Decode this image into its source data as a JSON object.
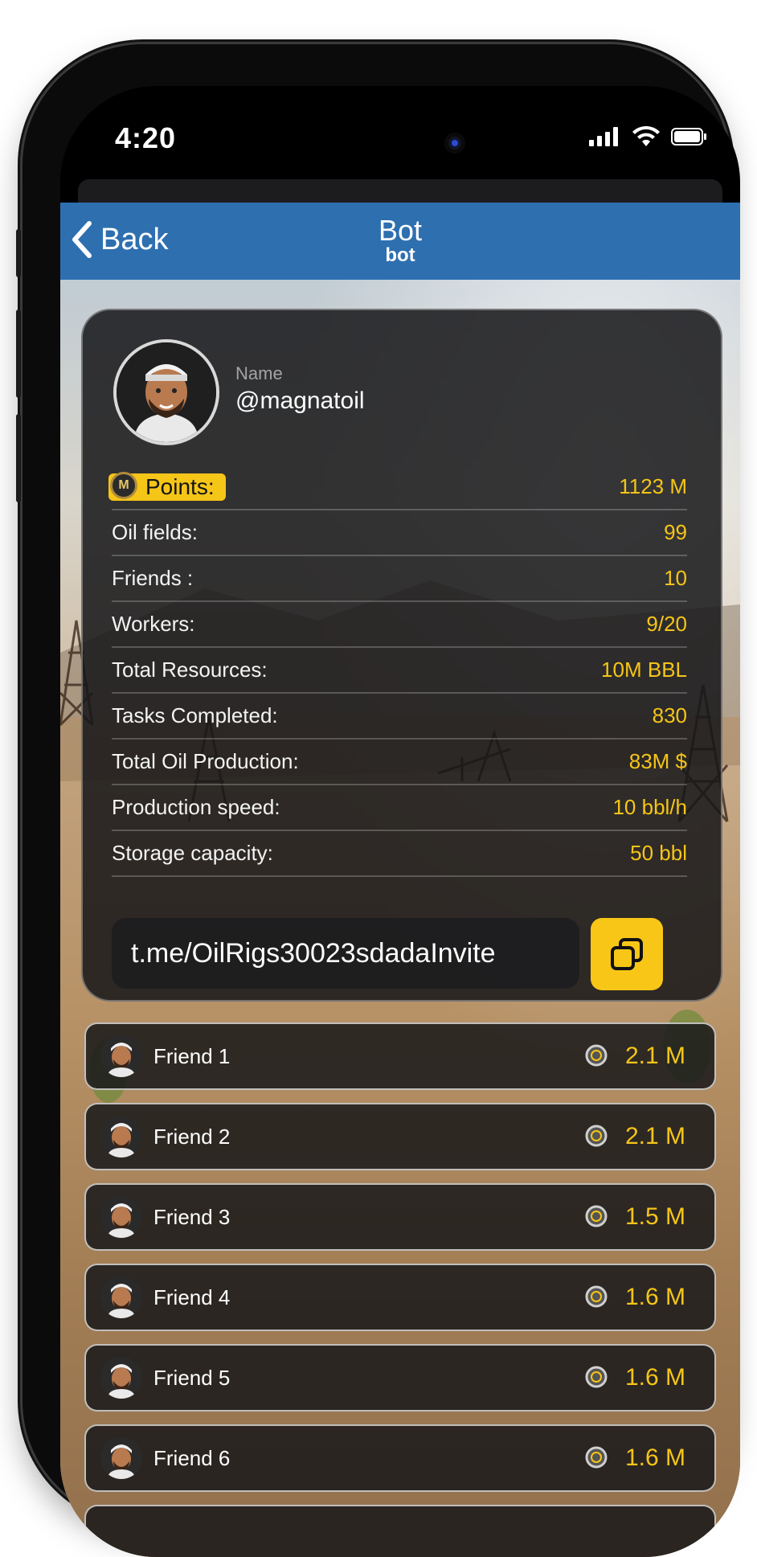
{
  "status_bar": {
    "time": "4:20"
  },
  "nav": {
    "back_label": "Back",
    "title": "Bot",
    "subtitle": "bot"
  },
  "profile": {
    "name_label": "Name",
    "username": "@magnatoil"
  },
  "points": {
    "label": "Points:",
    "coin_letter": "M",
    "value": "1123 M"
  },
  "stats": [
    {
      "label": "Oil fields:",
      "value": "99"
    },
    {
      "label": "Friends :",
      "value": "10"
    },
    {
      "label": "Workers:",
      "value": "9/20"
    },
    {
      "label": "Total Resources:",
      "value": "10M BBL"
    },
    {
      "label": "Tasks Completed:",
      "value": "830"
    },
    {
      "label": "Total Oil Production:",
      "value": "83M $"
    },
    {
      "label": "Production speed:",
      "value": "10 bbl/h"
    },
    {
      "label": "Storage capacity:",
      "value": "50 bbl"
    }
  ],
  "invite": {
    "link": "t.me/OilRigs30023sdadaInvite",
    "copy_icon": "copy-icon"
  },
  "friends": [
    {
      "name": "Friend 1",
      "amount": "2.1 M"
    },
    {
      "name": "Friend 2",
      "amount": "2.1 M"
    },
    {
      "name": "Friend 3",
      "amount": "1.5 M"
    },
    {
      "name": "Friend 4",
      "amount": "1.6 M"
    },
    {
      "name": "Friend 5",
      "amount": "1.6 M"
    },
    {
      "name": "Friend 6",
      "amount": "1.6 M"
    }
  ],
  "colors": {
    "nav_bar": "#2e6fb0",
    "accent": "#f5c518",
    "card": "#161618"
  }
}
